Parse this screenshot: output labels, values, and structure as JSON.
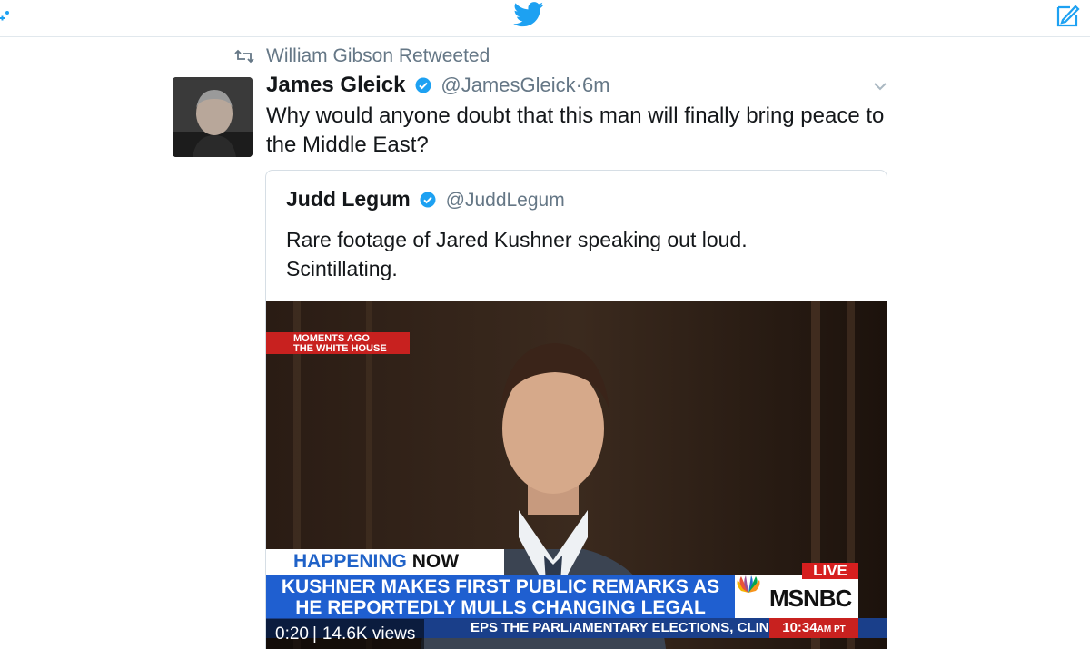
{
  "colors": {
    "twitter_blue": "#1da1f2",
    "secondary_text": "#657786",
    "msnbc_blue": "#1f5fd0",
    "msnbc_red": "#c8211f"
  },
  "topbar": {
    "left_icon": "add-user-icon",
    "center_icon": "twitter-bird-icon",
    "right_icon": "compose-tweet-icon"
  },
  "retweet_context": {
    "icon": "retweet-icon",
    "text": "William Gibson Retweeted"
  },
  "tweet": {
    "author_name": "James Gleick",
    "author_handle": "@JamesGleick",
    "dot": "·",
    "time": "6m",
    "verified_icon": "verified-badge-icon",
    "menu_icon": "chevron-down-icon",
    "text": "Why would anyone doubt that this man will finally bring peace to the Middle East?"
  },
  "quoted_tweet": {
    "author_name": "Judd Legum",
    "author_handle": "@JuddLegum",
    "text_line1": "Rare footage of Jared Kushner speaking out loud.",
    "text_line2": "Scintillating.",
    "video": {
      "tag_line1": "MOMENTS AGO",
      "tag_line2": "THE WHITE HOUSE",
      "happening_1": "HAPPENING",
      "happening_2": "NOW",
      "headline_line1": "KUSHNER MAKES FIRST PUBLIC REMARKS AS",
      "headline_line2": "HE REPORTEDLY MULLS CHANGING LEGAL TEAM",
      "live": "LIVE",
      "network": "MSNBC",
      "ticker": "EPS THE PARLIAMENTARY ELECTIONS, CLINCHING MA",
      "broadcast_time": "10:34",
      "broadcast_time_suffix": "AM PT",
      "duration": "0:20",
      "views": "14.6K views"
    }
  }
}
